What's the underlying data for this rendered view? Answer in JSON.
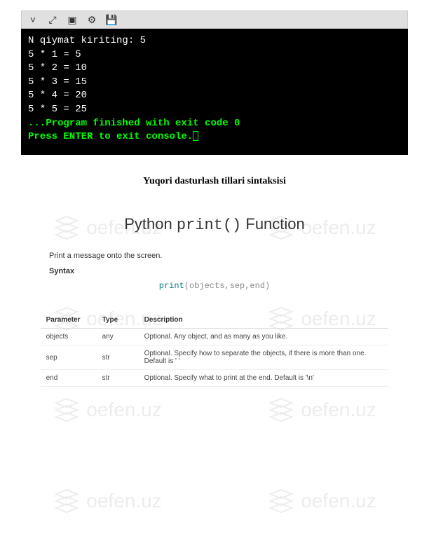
{
  "watermark": {
    "text": "oefen.uz"
  },
  "console": {
    "toolbar_icons": [
      "chevron-down",
      "expand",
      "window",
      "gear",
      "save"
    ],
    "lines": [
      "N qiymat kiriting: 5",
      "5 * 1 = 5",
      "5 * 2 = 10",
      "5 * 3 = 15",
      "5 * 4 = 20",
      "5 * 5 = 25",
      ""
    ],
    "finish_line": "...Program finished with exit code 0",
    "exit_line": "Press ENTER to exit console."
  },
  "title": "Yuqori dasturlash tillari sintaksisi",
  "python_section": {
    "heading_prefix": "Python ",
    "heading_func": "print()",
    "heading_suffix": " Function",
    "description": "Print a message onto the screen.",
    "syntax_label": "Syntax",
    "syntax_keyword": "print",
    "syntax_params": "(objects,sep,end)"
  },
  "table": {
    "headers": [
      "Parameter",
      "Type",
      "Description"
    ],
    "rows": [
      [
        "objects",
        "any",
        "Optional. Any object, and as many as you like."
      ],
      [
        "sep",
        "str",
        "Optional. Specify how to separate the objects, if there is more than one. Default is ' '"
      ],
      [
        "end",
        "str",
        "Optional. Specify what to print at the end. Default is '\\n'"
      ]
    ]
  }
}
